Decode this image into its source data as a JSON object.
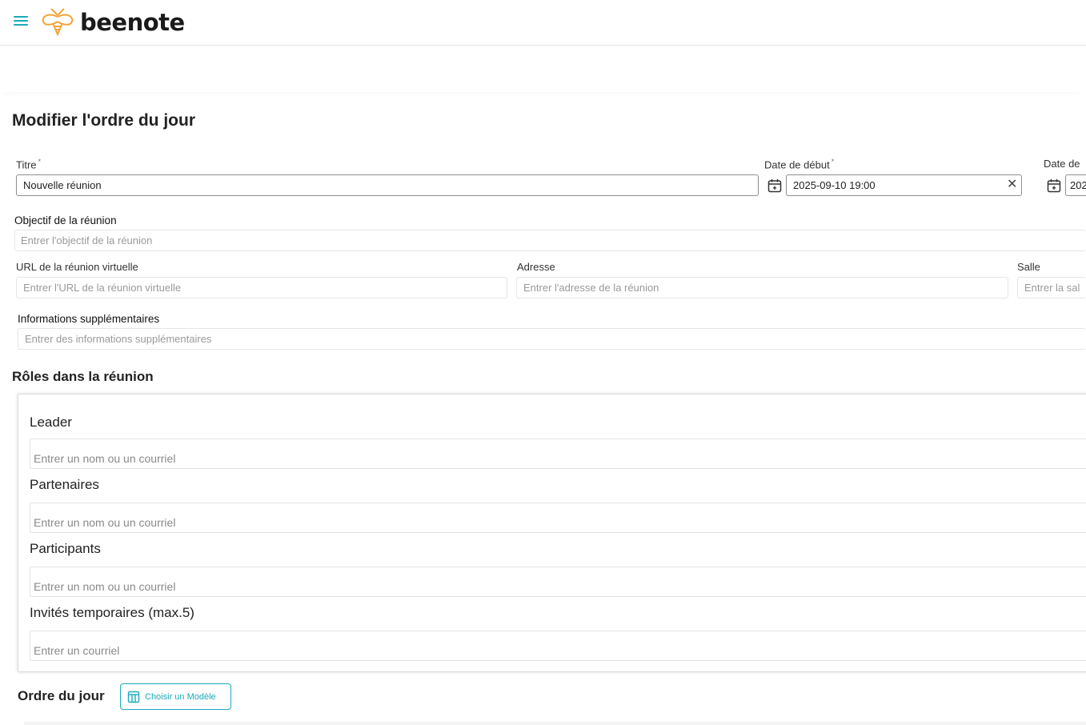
{
  "app": {
    "logo_text": "beenote",
    "accent_color": "#1aaab9",
    "logo_color": "#f2a53a"
  },
  "header": {
    "menu_icon": "hamburger-icon"
  },
  "page": {
    "title": "Modifier l'ordre du jour"
  },
  "form": {
    "title": {
      "label": "Titre",
      "required_mark": "*",
      "value": "Nouvelle réunion"
    },
    "start_date": {
      "label": "Date de début",
      "required_mark": "*",
      "value": "2025-09-10 19:00"
    },
    "end_date": {
      "label": "Date de",
      "value": "202"
    },
    "objective": {
      "label": "Objectif de la réunion",
      "placeholder": "Entrer l'objectif de la réunion"
    },
    "virtual_url": {
      "label": "URL de la réunion virtuelle",
      "placeholder": "Entrer l'URL de la réunion virtuelle"
    },
    "address": {
      "label": "Adresse",
      "placeholder": "Entrer l'adresse de la réunion"
    },
    "room": {
      "label": "Salle",
      "placeholder": "Entrer la sall"
    },
    "extra_info": {
      "label": "Informations supplémentaires",
      "placeholder": "Entrer des informations supplémentaires"
    }
  },
  "roles": {
    "title": "Rôles dans la réunion",
    "leader": {
      "label": "Leader",
      "placeholder": "Entrer un nom ou un courriel"
    },
    "partners": {
      "label": "Partenaires",
      "placeholder": "Entrer un nom ou un courriel"
    },
    "participants": {
      "label": "Participants",
      "placeholder": "Entrer un nom ou un courriel"
    },
    "guests": {
      "label": "Invités temporaires (max.5)",
      "placeholder": "Entrer un courriel"
    }
  },
  "agenda": {
    "title": "Ordre du jour",
    "choose_model_label": "Choisir un Modèle"
  }
}
